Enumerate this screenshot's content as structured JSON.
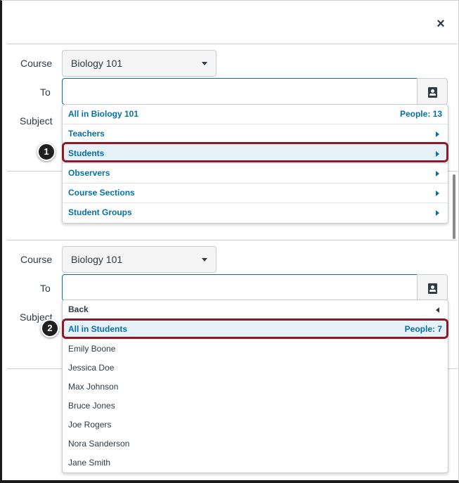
{
  "close_label": "×",
  "panel1": {
    "course_label": "Course",
    "course_value": "Biology 101",
    "to_label": "To",
    "subject_label": "Subject",
    "dropdown": [
      {
        "label": "All in Biology 101",
        "right": "People: 13"
      },
      {
        "label": "Teachers"
      },
      {
        "label": "Students",
        "highlighted": true
      },
      {
        "label": "Observers"
      },
      {
        "label": "Course Sections"
      },
      {
        "label": "Student Groups"
      }
    ],
    "callout_number": "1"
  },
  "panel2": {
    "course_label": "Course",
    "course_value": "Biology 101",
    "to_label": "To",
    "subject_label": "Subject",
    "back_label": "Back",
    "all_label": "All in Students",
    "all_count": "People: 7",
    "people": [
      "Emily Boone",
      "Jessica Doe",
      "Max Johnson",
      "Bruce Jones",
      "Joe Rogers",
      "Nora Sanderson",
      "Jane Smith"
    ],
    "callout_number": "2"
  },
  "colors": {
    "link": "#0770a3",
    "highlight": "#e6f1f7",
    "callout": "#8b1a2b"
  },
  "icons": {
    "close": "close-icon",
    "address_book": "address-book-icon",
    "caret": "chevron-down-icon",
    "submenu": "chevron-right-icon",
    "back": "chevron-left-icon"
  }
}
